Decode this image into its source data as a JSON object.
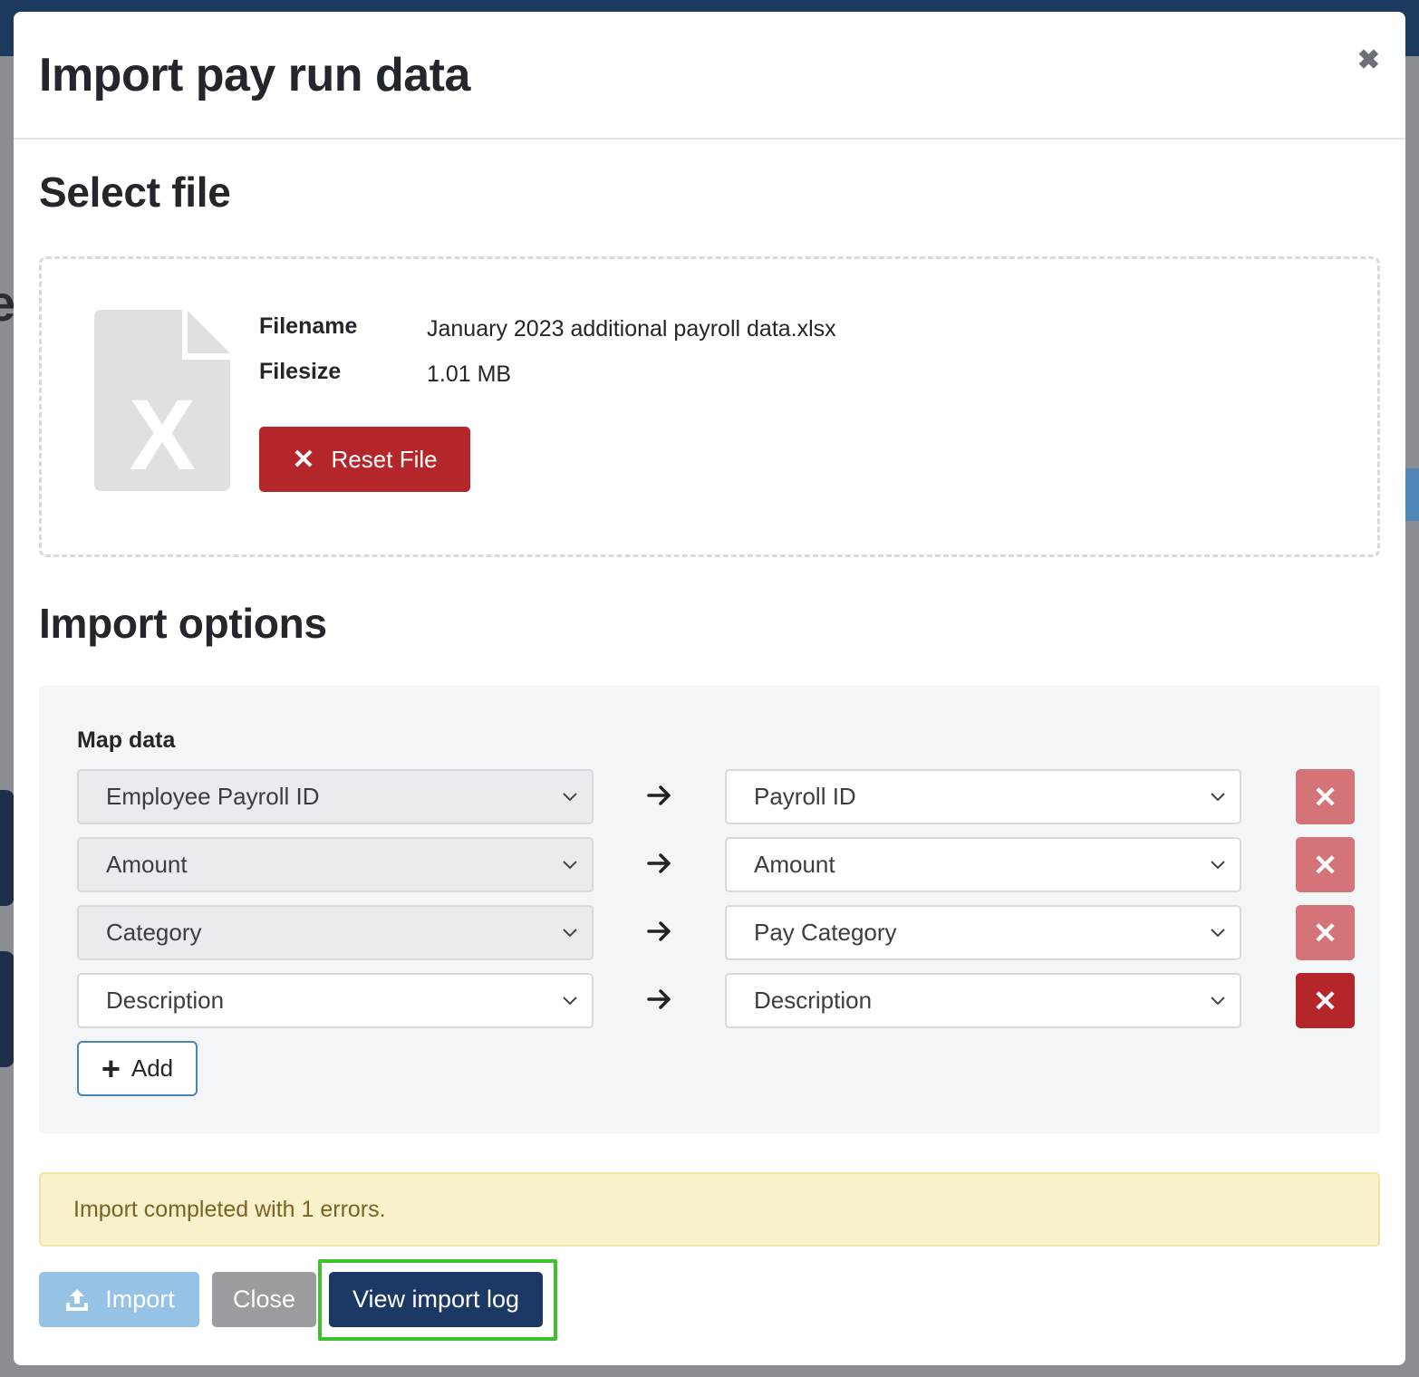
{
  "modal": {
    "title": "Import pay run data",
    "close_icon": "close-icon"
  },
  "select_file": {
    "heading": "Select file",
    "file_icon": "excel-file-icon",
    "filename_label": "Filename",
    "filename_value": "January 2023 additional payroll data.xlsx",
    "filesize_label": "Filesize",
    "filesize_value": "1.01 MB",
    "reset_label": "Reset File"
  },
  "import_options": {
    "heading": "Import options",
    "map_label": "Map data",
    "rows": [
      {
        "source": "Employee Payroll ID",
        "target": "Payroll ID"
      },
      {
        "source": "Amount",
        "target": "Amount"
      },
      {
        "source": "Category",
        "target": "Pay Category"
      },
      {
        "source": "Description",
        "target": "Description"
      }
    ],
    "add_label": "Add"
  },
  "alert": {
    "message": "Import completed with 1 errors."
  },
  "footer": {
    "import_label": "Import",
    "close_label": "Close",
    "view_log_label": "View import log"
  },
  "colors": {
    "danger": "#b5262b",
    "primary_dark": "#1c3864",
    "highlight": "#3fc12e",
    "warning_bg": "#f8f1cc"
  }
}
